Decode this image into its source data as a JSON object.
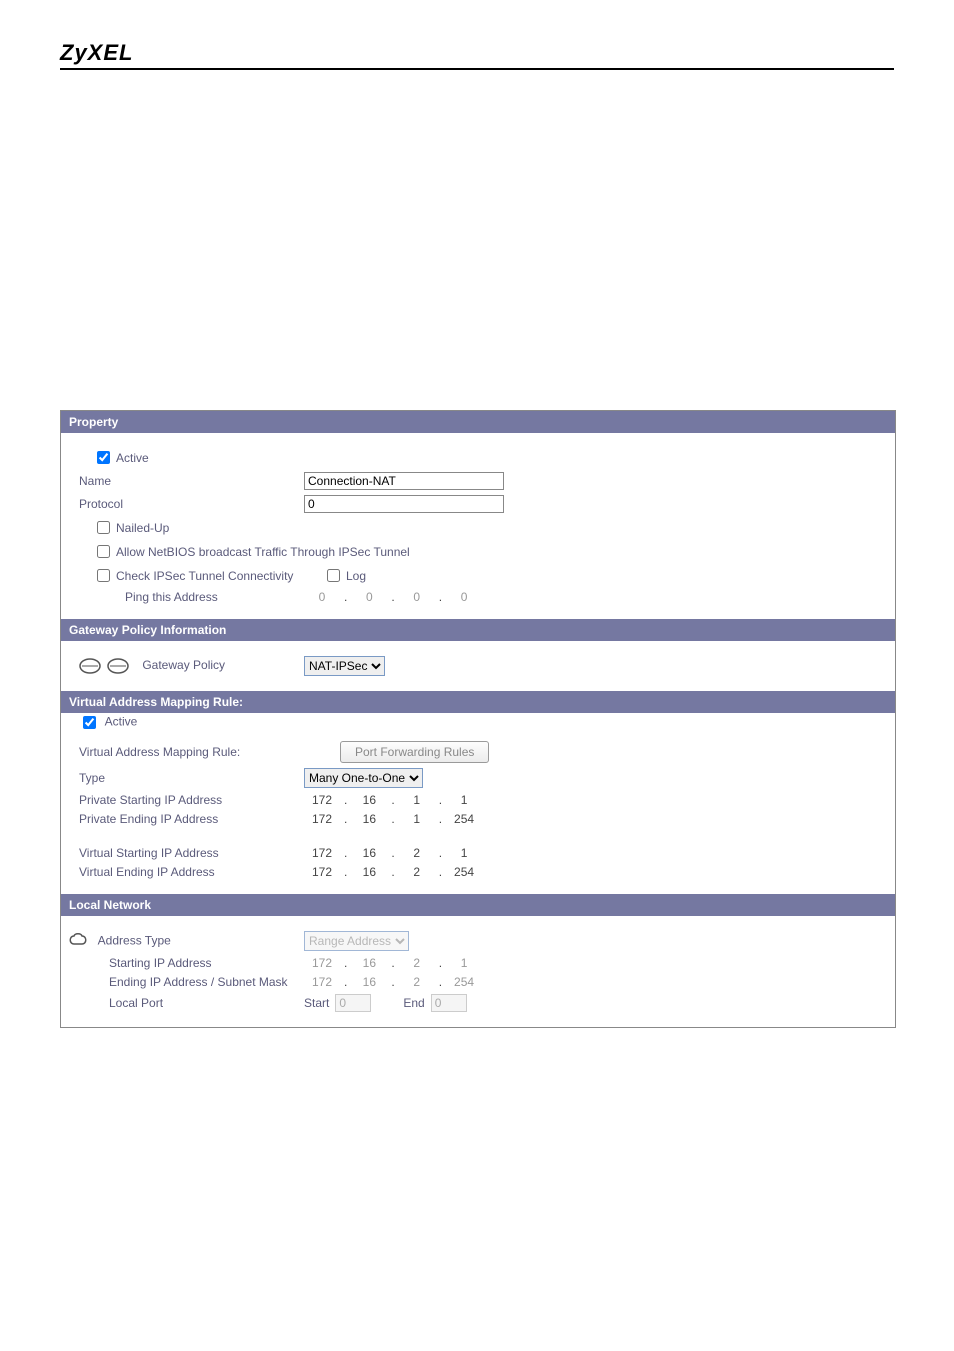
{
  "brand": "ZyXEL",
  "sections": {
    "property": {
      "title": "Property",
      "active_label": "Active",
      "active_checked": true,
      "name_label": "Name",
      "name_value": "Connection-NAT",
      "protocol_label": "Protocol",
      "protocol_value": "0",
      "nailed_up_label": "Nailed-Up",
      "nailed_up_checked": false,
      "netbios_label": "Allow NetBIOS broadcast Traffic Through IPSec Tunnel",
      "netbios_checked": false,
      "check_ipsec_label": "Check IPSec Tunnel Connectivity",
      "check_ipsec_checked": false,
      "log_label": "Log",
      "log_checked": false,
      "ping_label": "Ping this Address",
      "ping_ip": [
        "0",
        "0",
        "0",
        "0"
      ]
    },
    "gateway": {
      "title": "Gateway Policy Information",
      "policy_label": "Gateway Policy",
      "policy_value": "NAT-IPSec"
    },
    "virtual": {
      "title": "Virtual Address Mapping Rule:",
      "active_label": "Active",
      "active_checked": true,
      "rule_label": "Virtual Address Mapping Rule:",
      "button_label": "Port Forwarding Rules",
      "type_label": "Type",
      "type_value": "Many One-to-One",
      "priv_start_label": "Private Starting IP Address",
      "priv_start_ip": [
        "172",
        "16",
        "1",
        "1"
      ],
      "priv_end_label": "Private Ending IP Address",
      "priv_end_ip": [
        "172",
        "16",
        "1",
        "254"
      ],
      "virt_start_label": "Virtual Starting IP Address",
      "virt_start_ip": [
        "172",
        "16",
        "2",
        "1"
      ],
      "virt_end_label": "Virtual Ending IP Address",
      "virt_end_ip": [
        "172",
        "16",
        "2",
        "254"
      ]
    },
    "local": {
      "title": "Local Network",
      "addr_type_label": "Address Type",
      "addr_type_value": "Range Address",
      "start_ip_label": "Starting IP Address",
      "start_ip": [
        "172",
        "16",
        "2",
        "1"
      ],
      "end_ip_label": "Ending IP Address / Subnet Mask",
      "end_ip": [
        "172",
        "16",
        "2",
        "254"
      ],
      "local_port_label": "Local Port",
      "start_label": "Start",
      "start_value": "0",
      "end_label": "End",
      "end_value": "0"
    }
  }
}
